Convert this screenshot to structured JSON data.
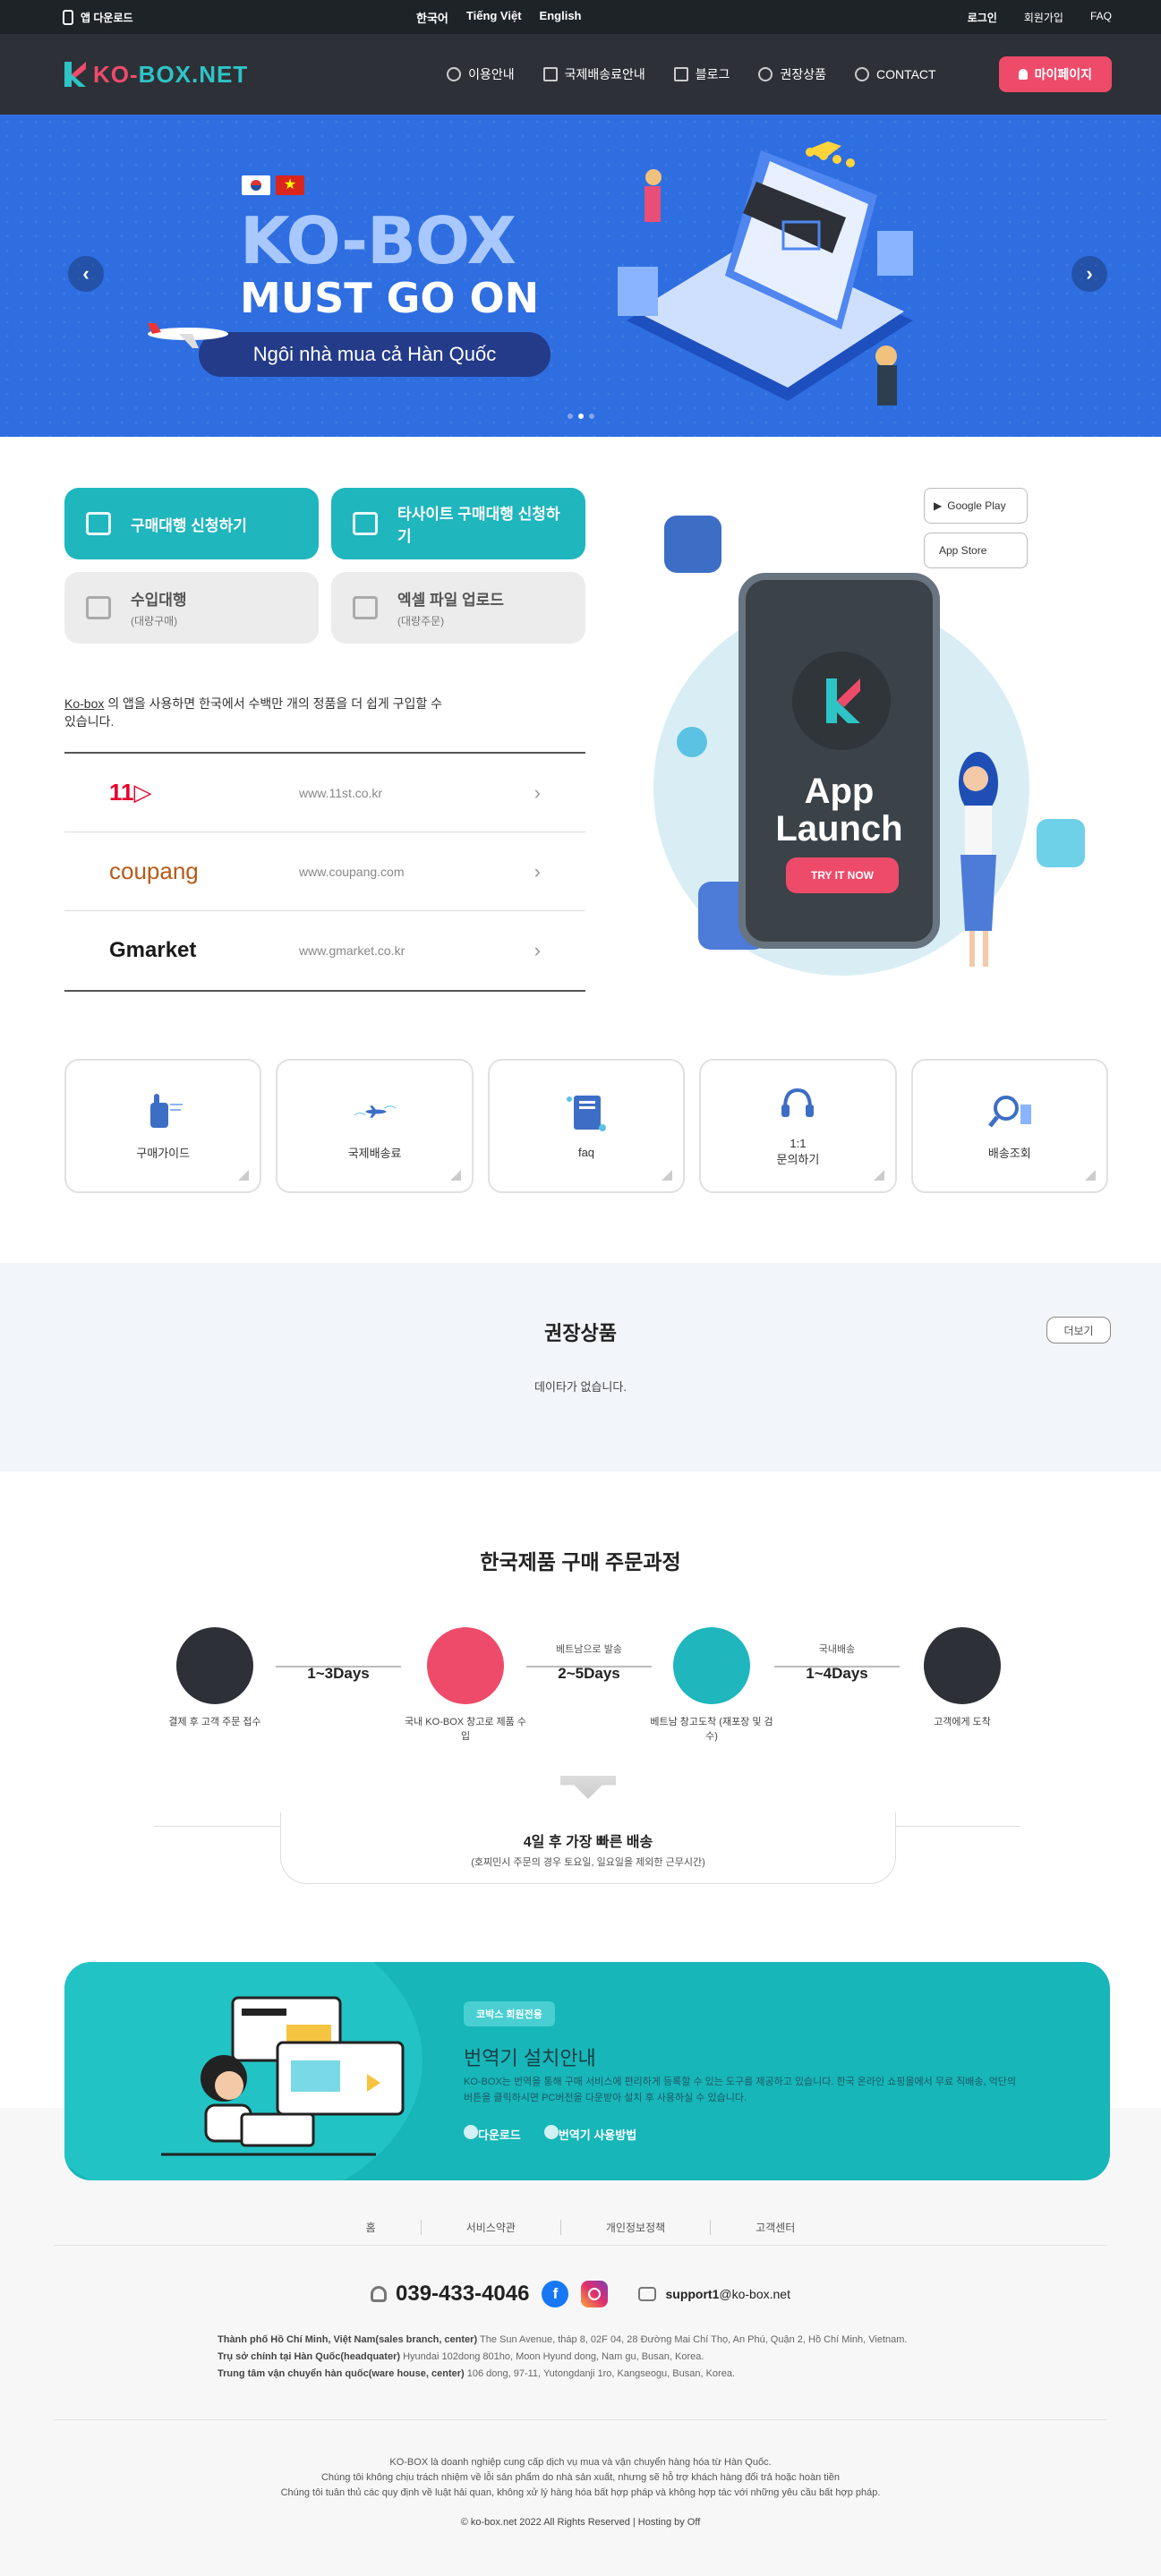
{
  "topbar": {
    "app_download": "앱 다운로드",
    "languages": [
      "한국어",
      "Tiếng Việt",
      "English"
    ],
    "login": "로그인",
    "signup": "회원가입",
    "faq": "FAQ"
  },
  "header": {
    "logo_a": "KO-",
    "logo_b": "BOX.NET",
    "nav": [
      "이용안내",
      "국제배송료안내",
      "블로그",
      "권장상품",
      "CONTACT"
    ],
    "mypage": "마이페이지"
  },
  "hero": {
    "title": "KO-BOX",
    "subtitle": "MUST GO ON",
    "tagline": "Ngôi nhà mua cả Hàn Quốc"
  },
  "actions": [
    {
      "label": "구매대행 신청하기",
      "sub": ""
    },
    {
      "label": "타사이트 구매대행 신청하기",
      "sub": ""
    },
    {
      "label": "수입대행",
      "sub": "(대량구매)"
    },
    {
      "label": "엑셀 파일 업로드",
      "sub": "(대량주문)"
    }
  ],
  "intro": {
    "brand": "Ko-box",
    "text": " 의 앱을 사용하면 한국에서 수백만 개의 정품을 더 쉽게 구입할 수 있습니다."
  },
  "malls": [
    {
      "logo": "11",
      "url": "www.11st.co.kr"
    },
    {
      "logo": "coupang",
      "url": "www.coupang.com"
    },
    {
      "logo": "Gmarket",
      "url": "www.gmarket.co.kr"
    }
  ],
  "app": {
    "google_play": "Google Play",
    "app_store": "App Store",
    "title_1": "App",
    "title_2": "Launch",
    "try": "TRY IT NOW"
  },
  "quick": [
    {
      "label": "구매가이드",
      "icon": "hand-pointer-icon"
    },
    {
      "label": "국제배송료",
      "icon": "airplane-icon"
    },
    {
      "label": "faq",
      "icon": "book-icon"
    },
    {
      "label": "1:1\n문의하기",
      "icon": "headset-icon"
    },
    {
      "label": "배송조회",
      "icon": "magnifier-box-icon"
    }
  ],
  "reco": {
    "title": "권장상품",
    "more": "더보기",
    "empty": "데이타가 없습니다."
  },
  "process": {
    "title": "한국제품 구매 주문과정",
    "steps": [
      {
        "label": "결제 후 고객 주문 접수"
      },
      {
        "label": "국내 KO-BOX 창고로 제품 수입"
      },
      {
        "label": "베트남 창고도착 (재포장 및 검수)"
      },
      {
        "label": "고객에게 도착"
      }
    ],
    "connectors": [
      {
        "small": "",
        "big": "1~3Days"
      },
      {
        "small": "베트남으로 발송",
        "big": "2~5Days"
      },
      {
        "small": "국내배송",
        "big": "1~4Days"
      }
    ],
    "summary_main": "4일 후 가장 빠른 배송",
    "summary_note": "(호찌민시 주문의 경우 토요일, 일요일을 제외한 근무시간)"
  },
  "translator": {
    "tag": "코박스 회원전용",
    "title": "번역기 설치안내",
    "desc": "KO-BOX는 번역을 통해 구매 서비스에 편리하게 등록할 수 있는 도구를 제공하고 있습니다. 한국 온라인 쇼핑몰에서 무료 직배송, 억단의 버튼을 클릭하시면 PC버전을 다운받아 설치 후 사용하실 수 있습니다.",
    "download": "다운로드",
    "howto": "번역기 사용방법"
  },
  "footer": {
    "nav": [
      "홈",
      "서비스약관",
      "개인정보정책",
      "고객센터"
    ],
    "phone": "039-433-4046",
    "email_user": "support1",
    "email_domain": "@ko-box.net",
    "addresses": [
      {
        "label": "Thành phố Hồ Chí Minh, Việt Nam(sales branch, center)",
        "value": " The Sun Avenue, tháp 8, 02F 04, 28 Đường Mai Chí Thọ, An Phú, Quận 2, Hồ Chí Minh, Vietnam."
      },
      {
        "label": "Trụ sở chính tại Hàn Quốc(headquater)",
        "value": " Hyundai 102dong 801ho, Moon Hyund dong, Nam gu, Busan, Korea."
      },
      {
        "label": "Trung tâm vận chuyển hàn quốc(ware house, center)",
        "value": " 106 dong, 97-11, Yutongdanji 1ro, Kangseogu, Busan, Korea."
      }
    ],
    "legal": [
      "KO-BOX là doanh nghiệp cung cấp dịch vụ mua và vận chuyển hàng hóa từ Hàn Quốc.",
      "Chúng tôi không chịu trách nhiệm về lỗi sản phẩm do nhà sản xuất, nhưng sẽ hỗ trợ khách hàng đổi trả hoặc hoàn tiền",
      "Chúng tôi tuân thủ các quy định về luật hải quan, không xử lý hàng hóa bất hợp pháp và không hợp tác với những yêu cầu bất hợp pháp."
    ],
    "copyright": "© ko-box.net 2022 All Rights Reserved | Hosting by Off"
  },
  "colors": {
    "teal": "#1fb6bd",
    "pink": "#ee4b6a",
    "dark": "#2d3137",
    "blue": "#2f6ee0"
  }
}
